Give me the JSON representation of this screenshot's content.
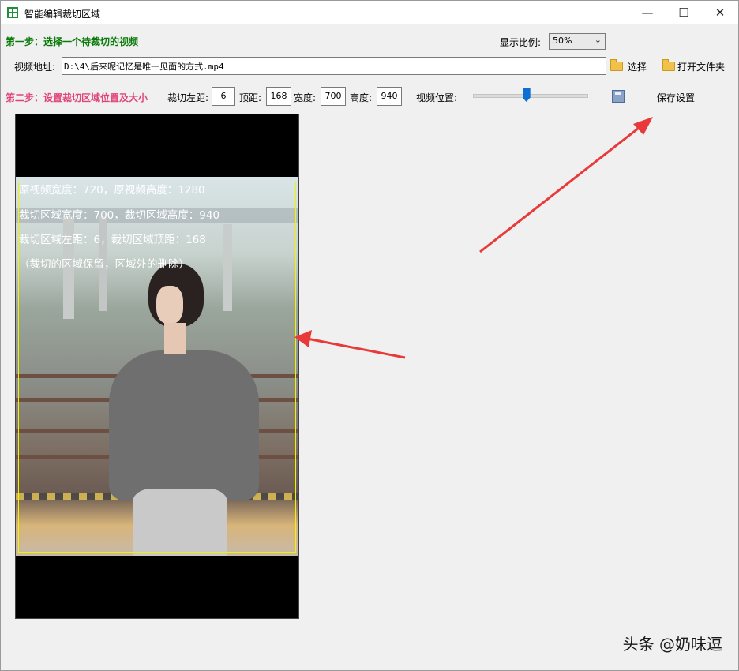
{
  "window": {
    "title": "智能编辑裁切区域",
    "minimize_glyph": "—",
    "maximize_glyph": "☐",
    "close_glyph": "✕"
  },
  "step1": {
    "label": "第一步：选择一个待裁切的视频",
    "ratio_label": "显示比例:",
    "ratio_value": "50%",
    "video_path_label": "视频地址:",
    "video_path_value": "D:\\4\\后来呢记忆是唯一见面的方式.mp4",
    "choose_button": "选择",
    "open_folder_button": "打开文件夹"
  },
  "step2": {
    "label": "第二步：设置裁切区域位置及大小",
    "left_label": "裁切左距:",
    "left_value": "6",
    "top_label": "顶距:",
    "top_value": "168",
    "width_label": "宽度:",
    "width_value": "700",
    "height_label": "高度:",
    "height_value": "940",
    "position_label": "视频位置:",
    "position_fraction": 0.47,
    "save_button": "保存设置"
  },
  "preview": {
    "lines": [
      "原视频宽度：720，原视频高度：1280",
      "裁切区域宽度：700，裁切区域高度：940",
      "裁切区域左距：6，裁切区域顶距：168",
      "（裁切的区域保留，区域外的删除）"
    ]
  },
  "watermark": "头条 @奶味逗",
  "colors": {
    "step1": "#0a7a0a",
    "step2": "#e0457a",
    "crop_frame": "#f2f200",
    "annotation_arrow": "#e83a3a",
    "slider_thumb": "#0c6fd1"
  }
}
